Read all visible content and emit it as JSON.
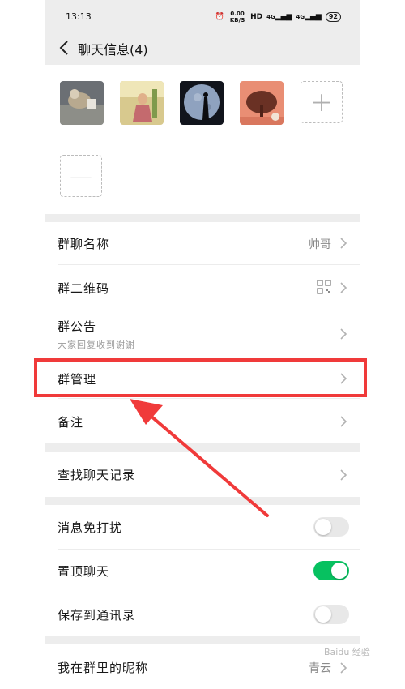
{
  "status_bar": {
    "time": "13:13",
    "network": "0.00 KB/S",
    "hd": "HD",
    "signal1": "4G",
    "signal2": "4G",
    "battery": "92"
  },
  "header": {
    "title": "聊天信息(4)"
  },
  "settings": {
    "group_name_label": "群聊名称",
    "group_name_value": "帅哥",
    "qrcode_label": "群二维码",
    "notice_label": "群公告",
    "notice_value": "大家回复收到谢谢",
    "manage_label": "群管理",
    "remark_label": "备注",
    "search_history_label": "查找聊天记录",
    "mute_label": "消息免打扰",
    "mute_on": false,
    "pin_label": "置顶聊天",
    "pin_on": true,
    "save_contacts_label": "保存到通讯录",
    "save_contacts_on": false,
    "nickname_label": "我在群里的昵称",
    "nickname_value": "青云"
  },
  "annotation": {
    "highlight_color": "#f03a3a"
  },
  "watermark": "Baidu 经验"
}
